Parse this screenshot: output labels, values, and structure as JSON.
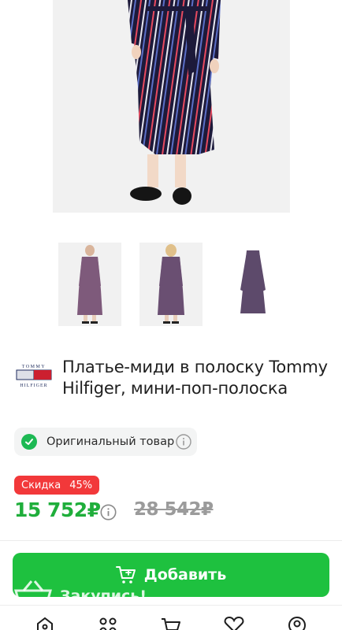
{
  "product": {
    "title": "Платье-миди в полоску Tommy Hilfiger, мини-поп-полоска",
    "brand_logo_lines": [
      "TOMMY",
      "HILFIGER"
    ],
    "original_label": "Оригинальный товар",
    "discount_label": "Скидка",
    "discount_value": "45%",
    "price": "15 752₽",
    "old_price": "28 542₽",
    "colors": {
      "accent": "#1ec13f",
      "price": "#1fae3b",
      "discount": "#f2383a"
    }
  },
  "actions": {
    "add_label": "Добавить",
    "promo_label": "Закупись!"
  },
  "gallery": {
    "thumbnails": [
      "model-front",
      "model-back",
      "dress-flat"
    ]
  },
  "nav": {
    "items": [
      "home-icon",
      "catalog-icon",
      "cart-icon",
      "favorites-icon",
      "profile-icon"
    ]
  }
}
